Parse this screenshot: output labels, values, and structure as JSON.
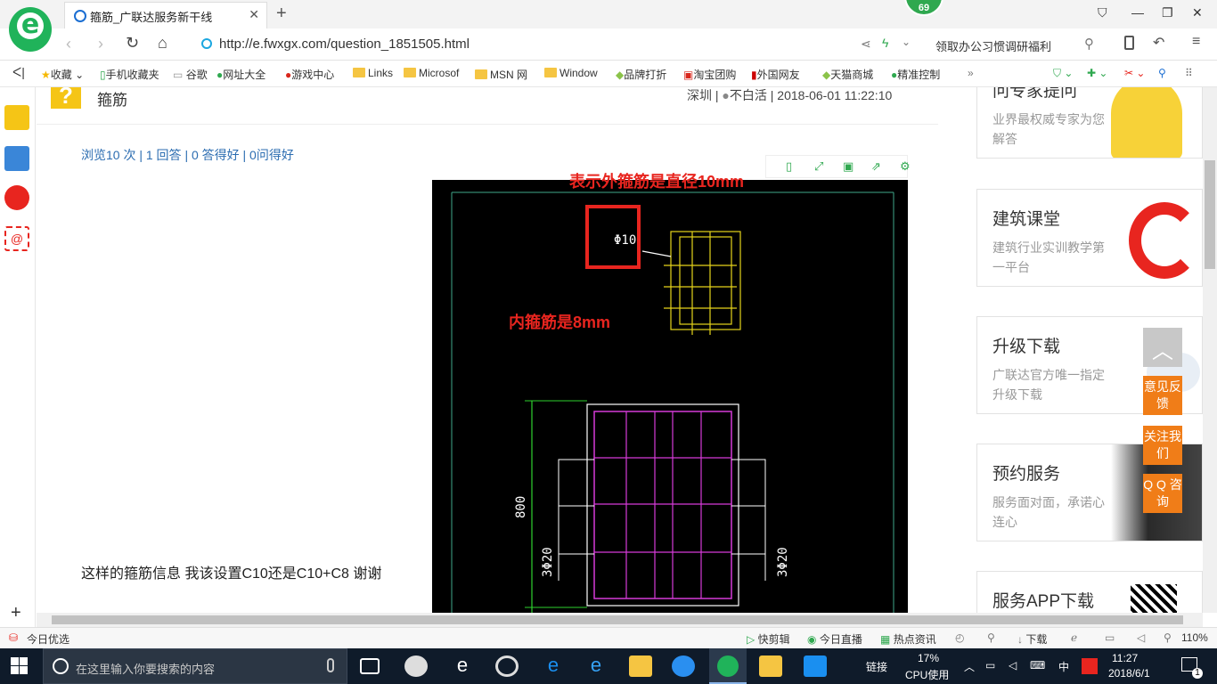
{
  "browser": {
    "tab_title": "箍筋_广联达服务新干线",
    "badge": "69",
    "url": "http://e.fwxgx.com/question_1851505.html",
    "promo": "领取办公习惯调研福利",
    "bookmarks": [
      "收藏",
      "手机收藏夹",
      "谷歌",
      "网址大全",
      "游戏中心",
      "Links",
      "Microsof",
      "MSN 网",
      "Window",
      "品牌打折",
      "淘宝团购",
      "外国网友",
      "天猫商城",
      "精准控制"
    ]
  },
  "question": {
    "title": "箍筋",
    "meta": "深圳 | ",
    "user": "不白活",
    "time": " | 2018-06-01 11:22:10",
    "stats": "浏览10 次 | 1 回答 | 0 答得好 | 0问得好",
    "text": "这样的箍筋信息  我该设置C10还是C10+C8  谢谢"
  },
  "image": {
    "annotation_outer": "表示外箍筋是直径10mm",
    "annotation_inner": "内箍筋是8mm",
    "label_phi10": "Φ10",
    "dim_800": "800",
    "rebar_left": "3Φ20",
    "rebar_right": "3Φ20"
  },
  "cards": [
    {
      "title": "问专家提问",
      "desc": "业界最权威专家为您解答"
    },
    {
      "title": "建筑课堂",
      "desc": "建筑行业实训教学第一平台"
    },
    {
      "title": "升级下载",
      "desc": "广联达官方唯一指定升级下载"
    },
    {
      "title": "预约服务",
      "desc": "服务面对面，承诺心连心"
    },
    {
      "title": "服务APP下载",
      "desc": ""
    }
  ],
  "floaters": {
    "feedback": "意见反馈",
    "follow": "关注我们",
    "qq": "Q Q 咨询"
  },
  "status_bar": {
    "left": "今日优选",
    "items": [
      "快剪辑",
      "今日直播",
      "热点资讯",
      "下载"
    ],
    "zoom": "110%"
  },
  "taskbar": {
    "search_placeholder": "在这里输入你要搜索的内容",
    "link": "链接",
    "cpu_pct": "17%",
    "cpu_label": "CPU使用",
    "ime": "中",
    "time": "11:27",
    "date": "2018/6/1",
    "notif": "1"
  }
}
